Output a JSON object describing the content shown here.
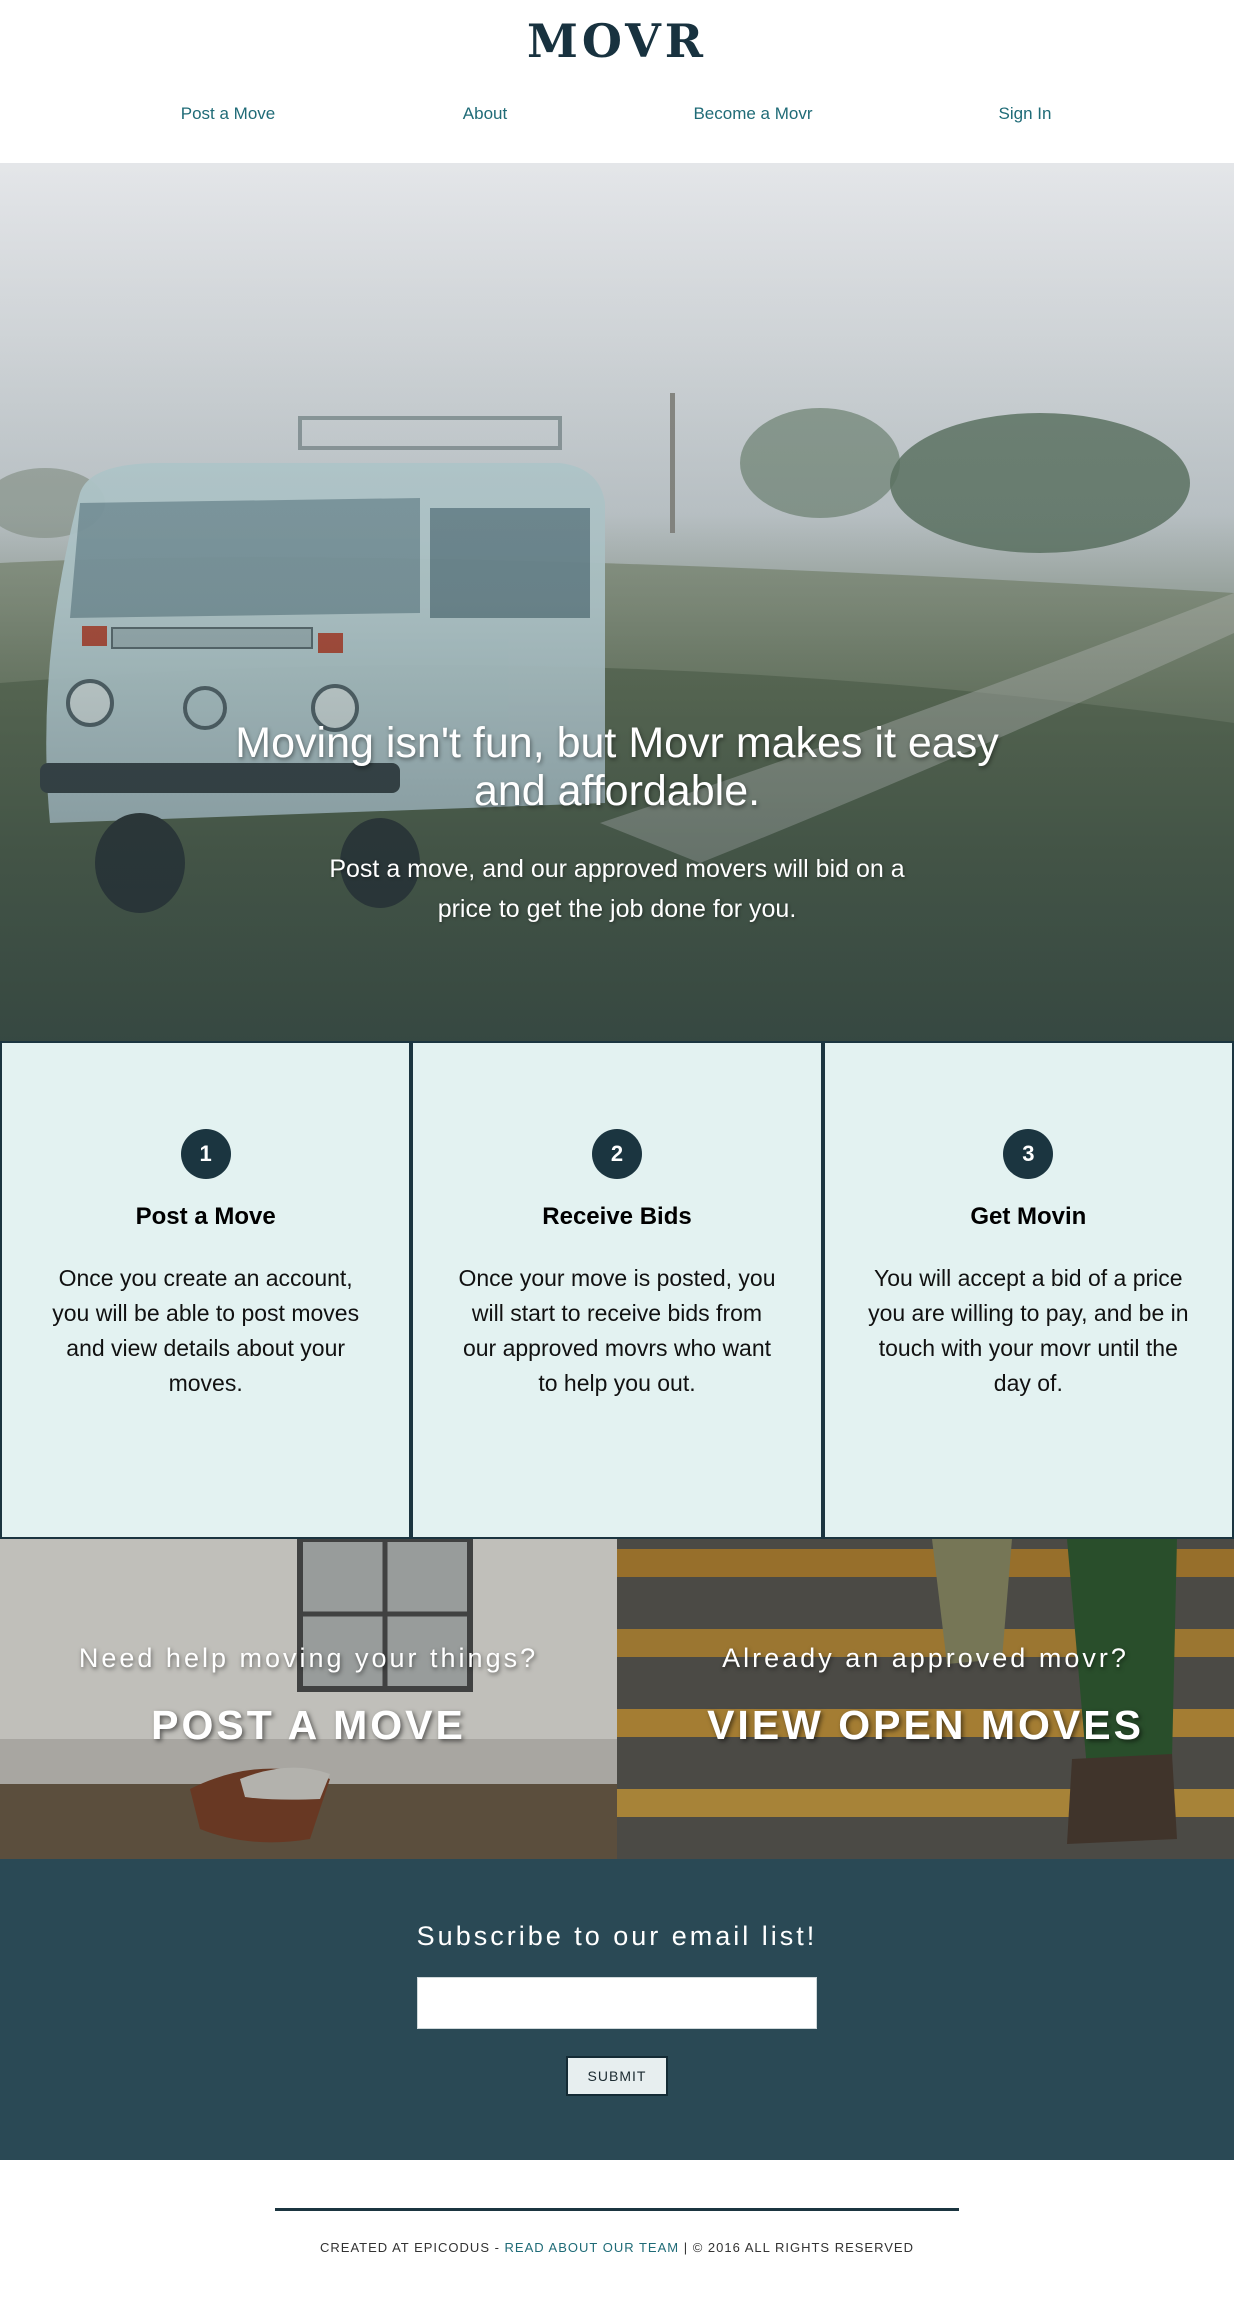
{
  "brand": {
    "logo": "MOVR"
  },
  "nav": [
    {
      "label": "Post a Move"
    },
    {
      "label": "About"
    },
    {
      "label": "Become a Movr"
    },
    {
      "label": "Sign In"
    }
  ],
  "hero": {
    "title_line1": "Moving isn't fun, but Movr makes it easy",
    "title_line2": "and affordable.",
    "sub_line1": "Post a move, and our approved movers will bid on a",
    "sub_line2": "price to get the job done for you."
  },
  "steps": [
    {
      "number": "1",
      "title": "Post a Move",
      "body": "Once you create an account, you will be able to post moves and view details about your moves."
    },
    {
      "number": "2",
      "title": "Receive Bids",
      "body": "Once your move is posted, you will start to receive bids from our approved movrs who want to help you out."
    },
    {
      "number": "3",
      "title": "Get Movin",
      "body": "You will accept a bid of a price you are willing to pay, and be in touch with your movr until the day of."
    }
  ],
  "cta": {
    "left": {
      "question": "Need help moving your things?",
      "button": "POST A MOVE"
    },
    "right": {
      "question": "Already an approved movr?",
      "button": "VIEW OPEN MOVES"
    }
  },
  "subscribe": {
    "title": "Subscribe to our email list!",
    "input_value": "",
    "button": "SUBMIT"
  },
  "footer": {
    "prefix": "CREATED AT EPICODUS - ",
    "link": "READ ABOUT OUR TEAM",
    "suffix": " | © 2016 ALL RIGHTS RESERVED"
  },
  "colors": {
    "primary_dark": "#1b3540",
    "nav_link": "#1f6b77",
    "step_bg": "#e3f2f1",
    "subscribe_bg": "#2a4955"
  },
  "icons": {
    "van_photo": "vw-van-image",
    "chair_photo": "chair-room-image",
    "stairs_photo": "stairs-feet-image"
  }
}
